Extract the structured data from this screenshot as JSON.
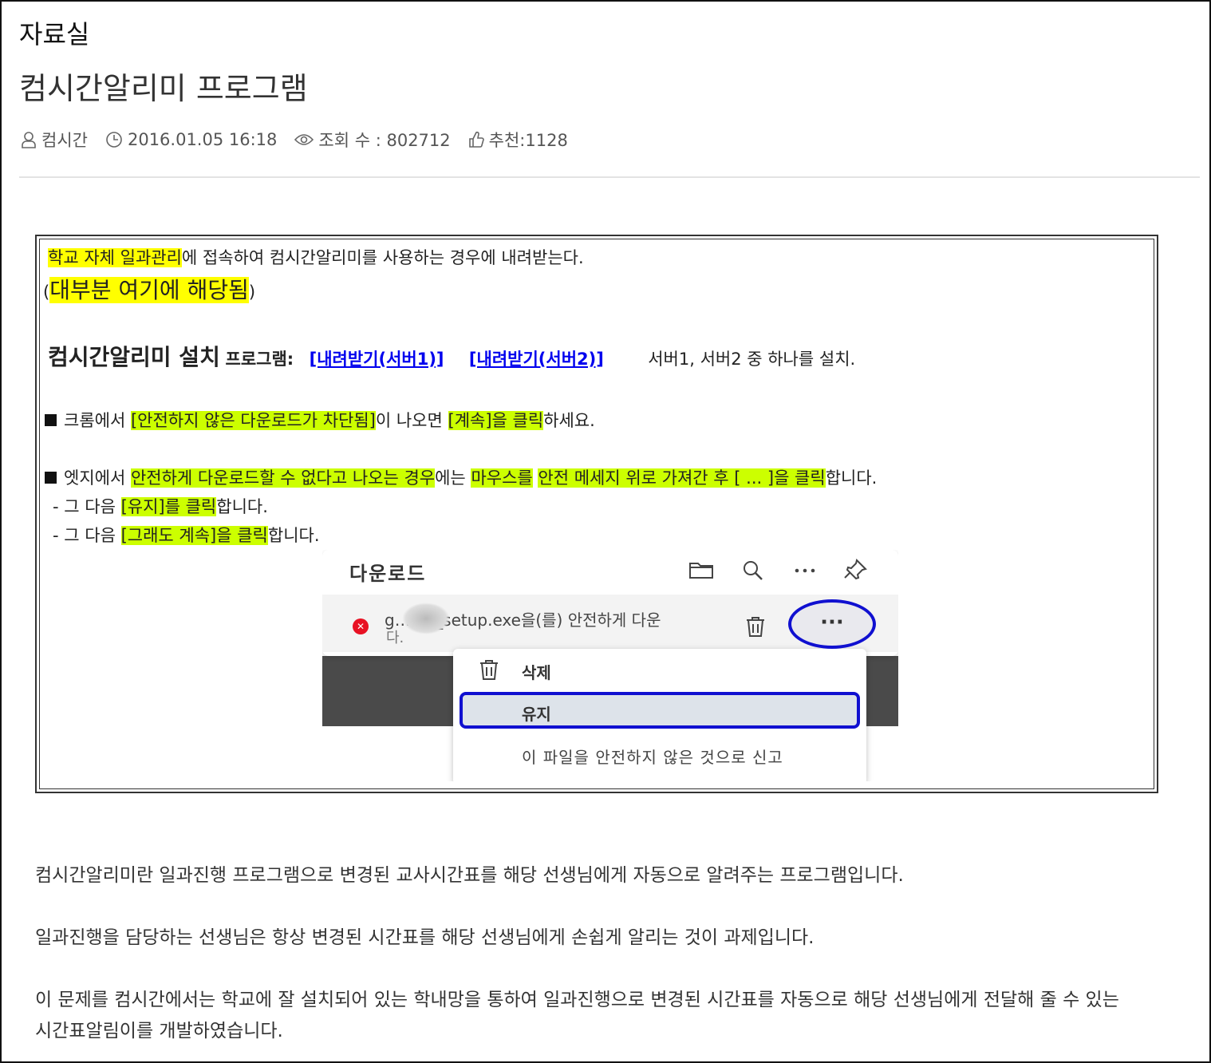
{
  "header": {
    "section_title": "자료실",
    "post_title": "컴시간알리미 프로그램",
    "author": "컴시간",
    "datetime": "2016.01.05 16:18",
    "views_label": "조회 수 : 802712",
    "likes_label": "추천:1128"
  },
  "notice": {
    "l1_hl": "학교 자체 일과관리",
    "l1_rest": "에 접속하여 컴시간알리미를 사용하는 경우에 내려받는다.",
    "l2_open": "(",
    "l2_hl": "대부분 여기에 해당됨",
    "l2_close": ")",
    "install_title": "컴시간알리미 설치",
    "program_label": "프로그램:",
    "download1": "[내려받기(서버1)]",
    "download2": "[내려받기(서버2)]",
    "install_note": "서버1, 서버2 중 하나를 설치.",
    "chrome_a": "크롬에서 ",
    "chrome_hl1": "[안전하지 않은 다운로드가 차단됨]",
    "chrome_b": "이 나오면 ",
    "chrome_hl2": "[계속]을 클릭",
    "chrome_c": "하세요.",
    "edge_a": "엣지에서 ",
    "edge_hl1": "안전하게 다운로드할 수 없다고 나오는 경우",
    "edge_b": "에는 ",
    "edge_hl2": "마우스를",
    "edge_hl3": "안전 메세지 위로 가져간 후 [ ... ]을 클릭",
    "edge_c": "합니다.",
    "step1_a": "- 그 다음 ",
    "step1_hl": "[유지]를 클릭",
    "step1_b": "합니다.",
    "step2_a": "- 그 다음 ",
    "step2_hl": "[그래도 계속]을 클릭",
    "step2_b": "합니다."
  },
  "screenshot": {
    "panel_title": "다운로드",
    "file_name": "g…log_setup.exe을(를) 안전하게 다운",
    "file_name_2": "다.",
    "more_label": "···",
    "menu_delete": "삭제",
    "menu_keep": "유지",
    "menu_report": "이 파일을 안전하지 않은 것으로 신고",
    "icons": [
      "folder-icon",
      "search-icon",
      "more-icon",
      "pin-icon",
      "error-icon",
      "trash-icon"
    ]
  },
  "body": {
    "p1": "컴시간알리미란 일과진행 프로그램으로 변경된 교사시간표를 해당 선생님에게 자동으로 알려주는 프로그램입니다.",
    "p2": "일과진행을 담당하는 선생님은 항상 변경된 시간표를 해당 선생님에게 손쉽게 알리는 것이 과제입니다.",
    "p3a": "이 문제를 컴시간에서는 학교에 잘 설치되어 있는 학내망을 통하여 일과진행으로 변경된 시간표를 자동으로 해당 선생님에게 전달해 줄 수 있는",
    "p3b": "시간표알림이를 개발하였습니다."
  },
  "colors": {
    "highlight_yellow": "#ffff00",
    "highlight_lime": "#ccff00",
    "link_blue": "#0000ee",
    "callout_blue": "#1010d0"
  }
}
